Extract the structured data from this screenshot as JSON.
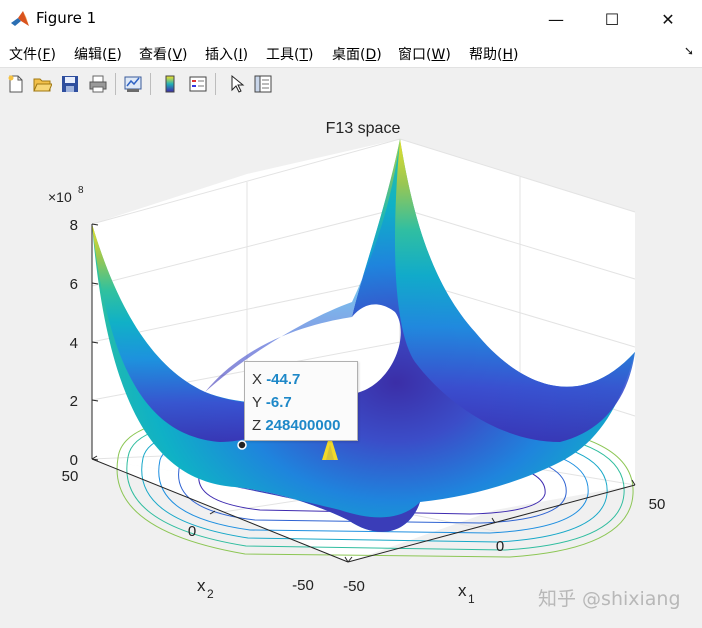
{
  "window": {
    "title": "Figure 1",
    "minimize_glyph": "—",
    "maximize_glyph": "☐",
    "close_glyph": "✕"
  },
  "menu": [
    {
      "label": "文件(",
      "key": "F",
      "end": ")"
    },
    {
      "label": "编辑(",
      "key": "E",
      "end": ")"
    },
    {
      "label": "查看(",
      "key": "V",
      "end": ")"
    },
    {
      "label": "插入(",
      "key": "I",
      "end": ")"
    },
    {
      "label": "工具(",
      "key": "T",
      "end": ")"
    },
    {
      "label": "桌面(",
      "key": "D",
      "end": ")"
    },
    {
      "label": "窗口(",
      "key": "W",
      "end": ")"
    },
    {
      "label": "帮助(",
      "key": "H",
      "end": ")"
    }
  ],
  "toolbar": [
    "new-figure-icon",
    "open-file-icon",
    "save-icon",
    "print-icon",
    "link-plot-icon",
    "insert-colorbar-icon",
    "insert-legend-icon",
    "edit-plot-cursor-icon",
    "property-inspector-icon"
  ],
  "plot": {
    "title": "F13 space",
    "exponent_base": "×10",
    "exponent": "8",
    "z_ticks": [
      "0",
      "2",
      "4",
      "6",
      "8"
    ],
    "x1_ticks": [
      "-50",
      "0",
      "50"
    ],
    "x2_ticks": [
      "-50",
      "0",
      "50"
    ],
    "x1_label": "x",
    "x1_sub": "1",
    "x2_label": "x",
    "x2_sub": "2"
  },
  "chart_data": {
    "type": "surface",
    "title": "F13 space",
    "xlabel": "x1",
    "ylabel": "x2",
    "zlabel": "",
    "xlim": [
      -50,
      50
    ],
    "ylim": [
      -50,
      50
    ],
    "zlim": [
      0,
      800000000
    ],
    "z_ticks": [
      0,
      200000000,
      400000000,
      600000000,
      800000000
    ],
    "colormap": "parula",
    "contours_on_floor": true,
    "grid": true
  },
  "datatip": {
    "x_label": "X",
    "x_value": "-44.7",
    "y_label": "Y",
    "y_value": "-6.7",
    "z_label": "Z",
    "z_value": "248400000"
  },
  "watermark": "知乎 @shixiang"
}
